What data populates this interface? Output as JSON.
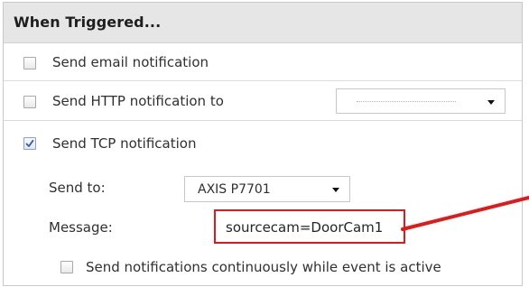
{
  "header": {
    "title": "When Triggered..."
  },
  "options": {
    "email": {
      "label": "Send email notification",
      "checked": false
    },
    "http": {
      "label": "Send HTTP notification to",
      "checked": false,
      "select_value": ""
    },
    "tcp": {
      "label": "Send TCP notification",
      "checked": true
    }
  },
  "tcp_settings": {
    "send_to_label": "Send to:",
    "send_to_value": "AXIS P7701",
    "message_label": "Message:",
    "message_value": "sourcecam=DoorCam1"
  },
  "continuous": {
    "label": "Send notifications continuously while event is active",
    "checked": false
  },
  "colors": {
    "header_bg": "#e6e6e6",
    "highlight": "#e01a1a",
    "checkmark": "#3b5a9a"
  },
  "icons": {
    "checkbox": "checkbox-icon",
    "check": "checkmark-icon",
    "dropdown": "triangle-down-icon",
    "annotation": "red-arrow-line"
  }
}
